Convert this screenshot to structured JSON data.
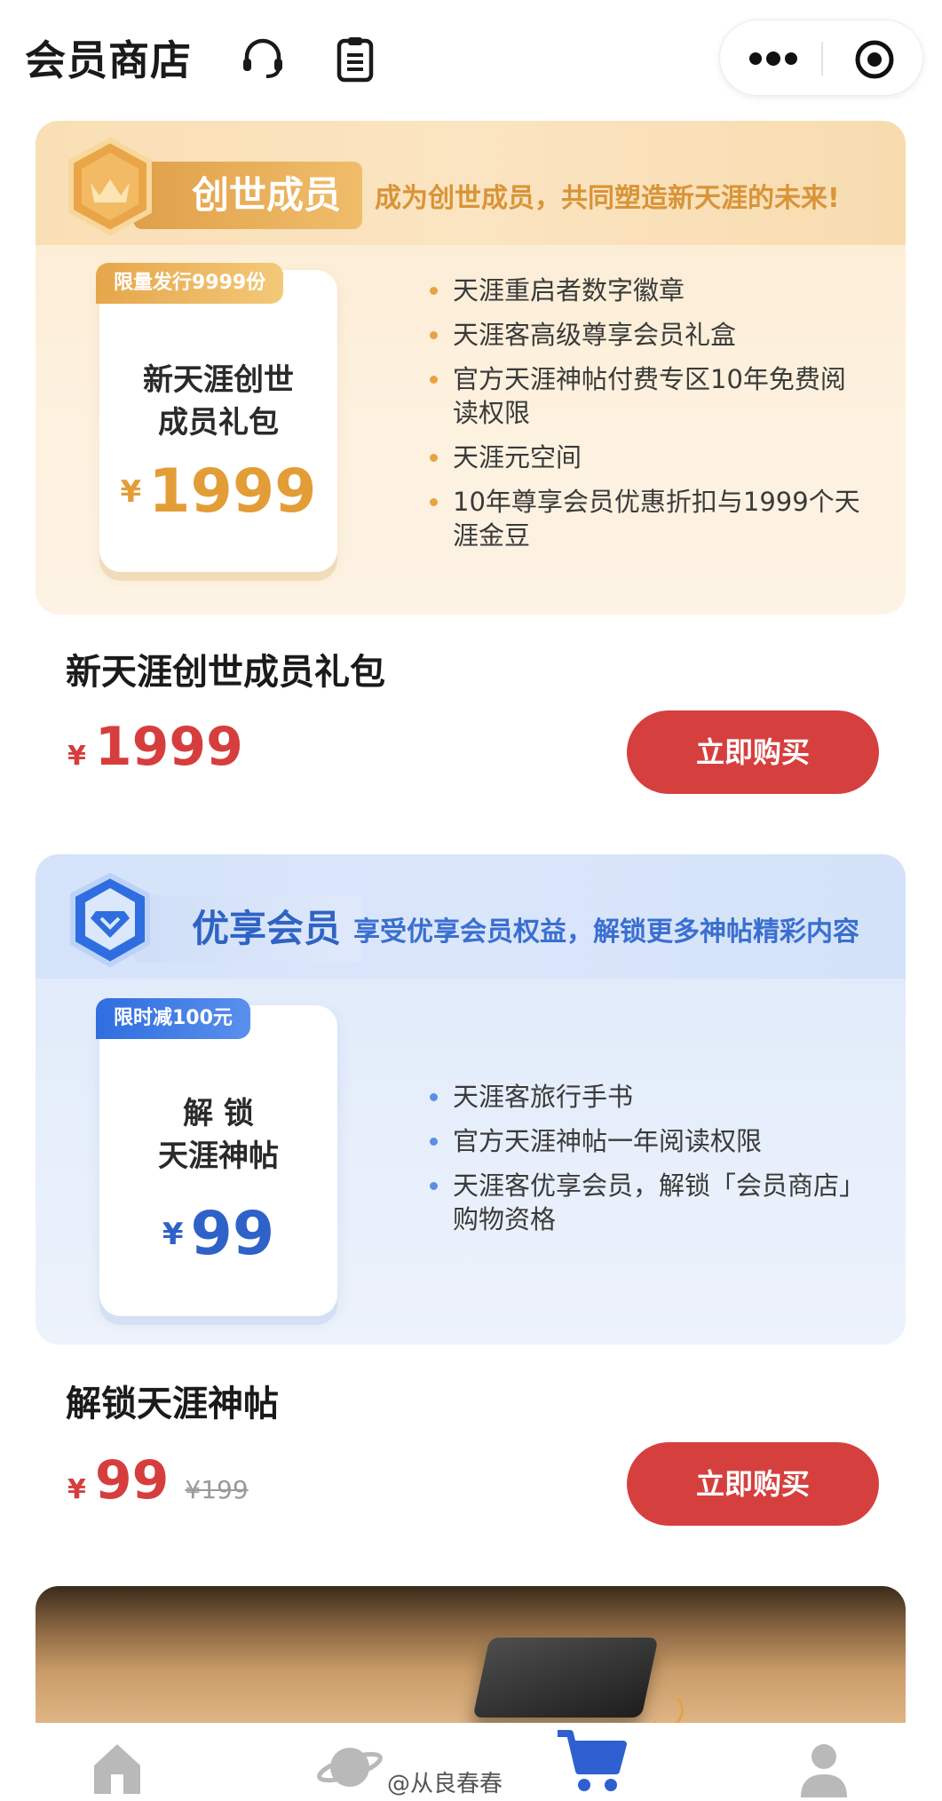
{
  "header": {
    "title": "会员商店",
    "support_icon": "headset-icon",
    "orders_icon": "clipboard-icon",
    "menu_icon": "more-dots-icon",
    "close_icon": "target-icon"
  },
  "products": [
    {
      "badge": "创世成员",
      "badge_icon": "crown-icon",
      "tagline": "成为创世成员，共同塑造新天涯的未来!",
      "ribbon": "限量发行9999份",
      "box_name_line1": "新天涯创世",
      "box_name_line2": "成员礼包",
      "currency": "¥",
      "box_price": "1999",
      "perks": [
        "天涯重启者数字徽章",
        "天涯客高级尊享会员礼盒",
        "官方天涯神帖付费专区10年免费阅读权限",
        "天涯元空间",
        "10年尊享会员优惠折扣与1999个天涯金豆"
      ],
      "title": "新天涯创世成员礼包",
      "price": "1999",
      "original_price": "",
      "buy_label": "立即购买",
      "theme_color": "#e39d36"
    },
    {
      "badge": "优享会员",
      "badge_icon": "diamond-shield-icon",
      "tagline": "享受优享会员权益，解锁更多神帖精彩内容",
      "ribbon": "限时减100元",
      "box_name_line1": "解 锁",
      "box_name_line2": "天涯神帖",
      "currency": "¥",
      "box_price": "99",
      "perks": [
        "天涯客旅行手书",
        "官方天涯神帖一年阅读权限",
        "天涯客优享会员，解锁「会员商店」购物资格"
      ],
      "title": "解锁天涯神帖",
      "price": "99",
      "original_price": "¥199",
      "buy_label": "立即购买",
      "theme_color": "#2f62c9"
    }
  ],
  "tabbar": {
    "items": [
      {
        "icon": "home-icon"
      },
      {
        "icon": "planet-icon"
      },
      {
        "icon": "cart-icon",
        "active": true
      },
      {
        "icon": "user-icon"
      }
    ]
  },
  "watermark": "@从良春春",
  "accent_color": "#d5403f"
}
